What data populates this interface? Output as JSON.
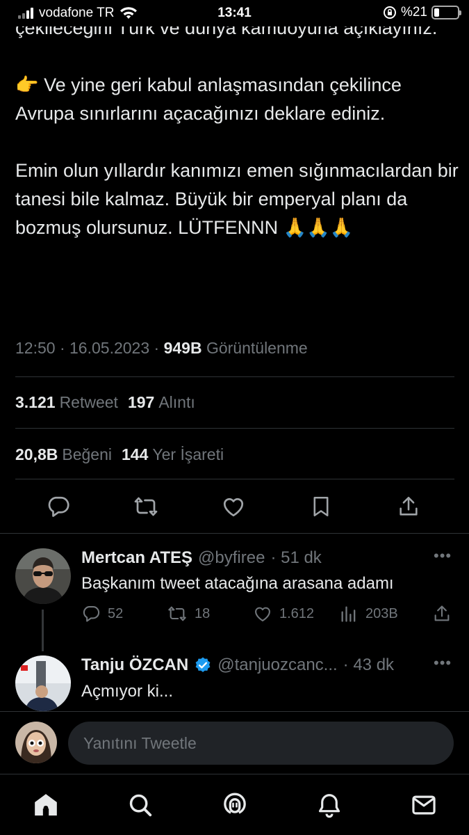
{
  "status_bar": {
    "carrier": "vodafone TR",
    "time": "13:41",
    "battery": "%21",
    "battery_level": 0.21
  },
  "tweet": {
    "paragraphs": [
      "çekileceğini Türk ve dünya kamuoyuna açıklayınız.",
      "👉 Ve yine geri kabul anlaşmasından çekilince Avrupa sınırlarını açacağınızı deklare ediniz.",
      "Emin olun yıllardır kanımızı emen sığınmacılardan bir tanesi bile kalmaz. Büyük bir emperyal planı da bozmuş olursunuz. LÜTFENNN 🙏🙏🙏"
    ],
    "time": "12:50",
    "separator": "·",
    "date": "16.05.2023",
    "views_count": "949B",
    "views_label": "Görüntülenme",
    "retweet_count": "3.121",
    "retweet_label": "Retweet",
    "quote_count": "197",
    "quote_label": "Alıntı",
    "like_count": "20,8B",
    "like_label": "Beğeni",
    "bookmark_count": "144",
    "bookmark_label": "Yer İşareti"
  },
  "icons": {
    "reply": "reply-icon",
    "retweet": "retweet-icon",
    "like": "heart-icon",
    "bookmark": "bookmark-icon",
    "share": "share-icon",
    "views": "views-icon",
    "more": "more-icon",
    "verified": "verified-badge-icon"
  },
  "replies": [
    {
      "name": "Mertcan ATEŞ",
      "handle": "@byfiree",
      "time": "· 51 dk",
      "text": "Başkanım tweet atacağına arasana adamı",
      "reply_count": "52",
      "retweet_count": "18",
      "like_count": "1.612",
      "views_count": "203B"
    },
    {
      "name": "Tanju ÖZCAN",
      "handle": "@tanjuozcanc...",
      "time": "· 43 dk",
      "text": "Açmıyor ki..."
    }
  ],
  "reply_bar": {
    "placeholder": "Yanıtını Tweetle"
  },
  "tab_bar": [
    "home-icon",
    "search-icon",
    "spaces-icon",
    "notifications-icon",
    "messages-icon"
  ],
  "colors": {
    "background": "#000000",
    "text": "#e7e9ea",
    "muted": "#71767b",
    "divider": "#2f3336",
    "verified": "#1d9bf0"
  }
}
